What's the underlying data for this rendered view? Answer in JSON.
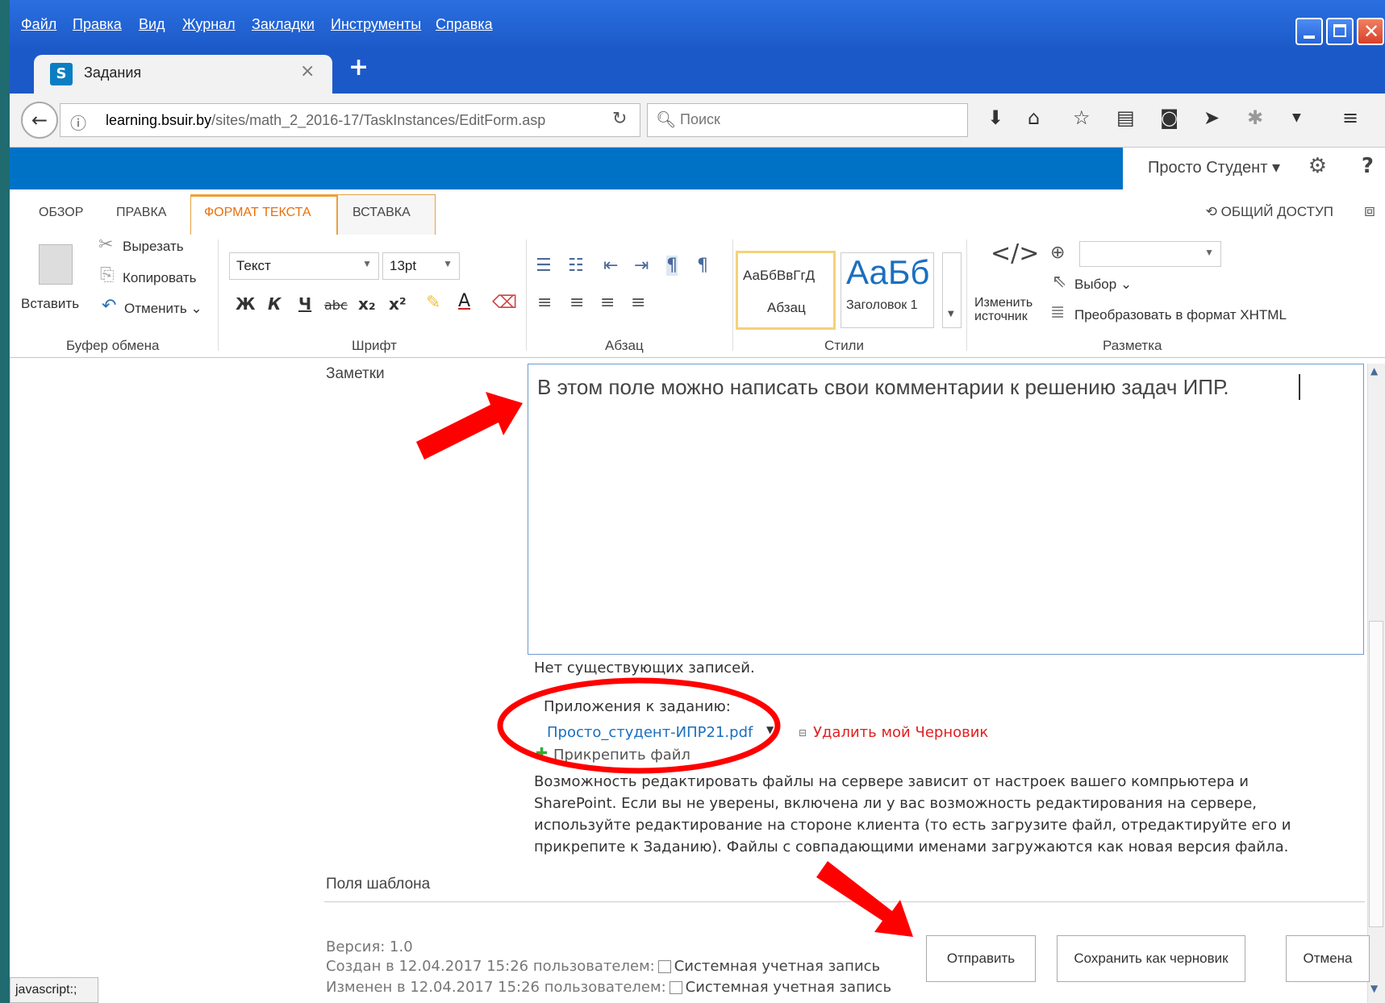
{
  "browser": {
    "menu": [
      "Файл",
      "Правка",
      "Вид",
      "Журнал",
      "Закладки",
      "Инструменты",
      "Справка"
    ],
    "tab_title": "Задания",
    "url_domain": "learning.bsuir.by",
    "url_path": "/sites/math_2_2016-17/TaskInstances/EditForm.asp",
    "search_placeholder": "Поиск"
  },
  "sharepoint": {
    "user_name": "Просто Студент",
    "help": "?",
    "tabs": [
      "ОБЗОР",
      "ПРАВКА",
      "ФОРМАТ ТЕКСТА",
      "ВСТАВКА"
    ],
    "share_label": "ОБЩИЙ ДОСТУП"
  },
  "ribbon": {
    "clipboard": {
      "paste": "Вставить",
      "cut": "Вырезать",
      "copy": "Копировать",
      "undo": "Отменить",
      "group": "Буфер обмена"
    },
    "font": {
      "family": "Текст",
      "size": "13pt",
      "group": "Шрифт",
      "bold": "Ж",
      "italic": "К",
      "underline": "Ч",
      "strike": "abc",
      "sub": "x₂",
      "sup": "x²"
    },
    "paragraph": {
      "group": "Абзац"
    },
    "styles": {
      "style1_sample": "АаБбВвГгД",
      "style1_name": "Абзац",
      "style2_sample": "АаБб",
      "style2_name": "Заголовок 1",
      "group": "Стили"
    },
    "markup": {
      "edit_source_1": "Изменить",
      "edit_source_2": "источник",
      "select": "Выбор",
      "convert": "Преобразовать в формат XHTML",
      "group": "Разметка"
    }
  },
  "form": {
    "notes_label": "Заметки",
    "notes_text": "В этом поле можно написать свои комментарии к решению задач ИПР.",
    "no_entries": "Нет существующих записей.",
    "attachments_label": "Приложения к заданию:",
    "attachment_file": "Просто_студент-ИПР21.pdf",
    "delete_draft": "Удалить мой Черновик",
    "attach_file": "Прикрепить файл",
    "info_lines": [
      "Возможность редактировать файлы на сервере зависит от настроек вашего компрьютера и",
      "SharePoint. Если вы не уверены, включена ли у вас возможность редактирования на сервере,",
      "используйте редактирование на стороне клиента (то есть загрузите файл, отредактируйте его и",
      "прикрепите к Заданию). Файлы с совпадающими именами загружаются как новая версия файла."
    ],
    "template_fields": "Поля шаблона",
    "version": "Версия: 1.0",
    "created_prefix": "Создан в 12.04.2017 15:26 пользователем:",
    "modified_prefix": "Изменен в 12.04.2017 15:26 пользователем:",
    "system_account": "Системная учетная запись",
    "buttons": {
      "submit": "Отправить",
      "save_draft": "Сохранить как черновик",
      "cancel": "Отмена"
    }
  },
  "status_bar": "javascript:;",
  "colors": {
    "firefox_blue": "#1c59c8",
    "sharepoint_blue": "#0072c6",
    "ribbon_accent": "#e8700a",
    "annotation_red": "#ff0000",
    "delete_link": "#e02020",
    "file_link": "#1a6fc0"
  }
}
